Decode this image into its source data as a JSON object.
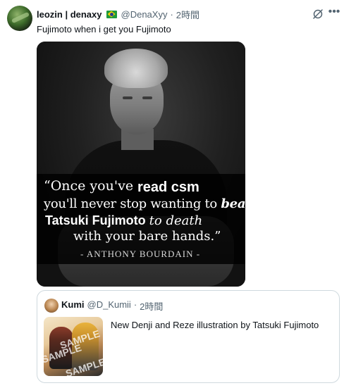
{
  "author": {
    "display_name": "leozin | denaxy",
    "flag_icon": "brazil-flag-icon",
    "handle": "@DenaXyy",
    "separator": "·",
    "time": "2時間"
  },
  "tweet": {
    "text": "Fujimoto when i get you Fujimoto"
  },
  "media": {
    "quote_line1_serif": "“Once you've",
    "quote_line1_bold": "read csm",
    "quote_line2_prefix": "you'll never stop wanting to ",
    "quote_line2_italic": "beat",
    "quote_line3_bold": "Tatsuki Fujimoto ",
    "quote_line3_italic": "to death",
    "quote_line4": "with your bare hands.”",
    "attribution": "- ANTHONY BOURDAIN -"
  },
  "quoted_tweet": {
    "display_name": "Kumi",
    "handle": "@D_Kumii",
    "separator": "·",
    "time": "2時間",
    "text": "New Denji and Reze illustration by Tatsuki Fujimoto",
    "watermark": "SAMPLE"
  },
  "icons": {
    "grok": "grok-icon",
    "more": "more-icon"
  }
}
